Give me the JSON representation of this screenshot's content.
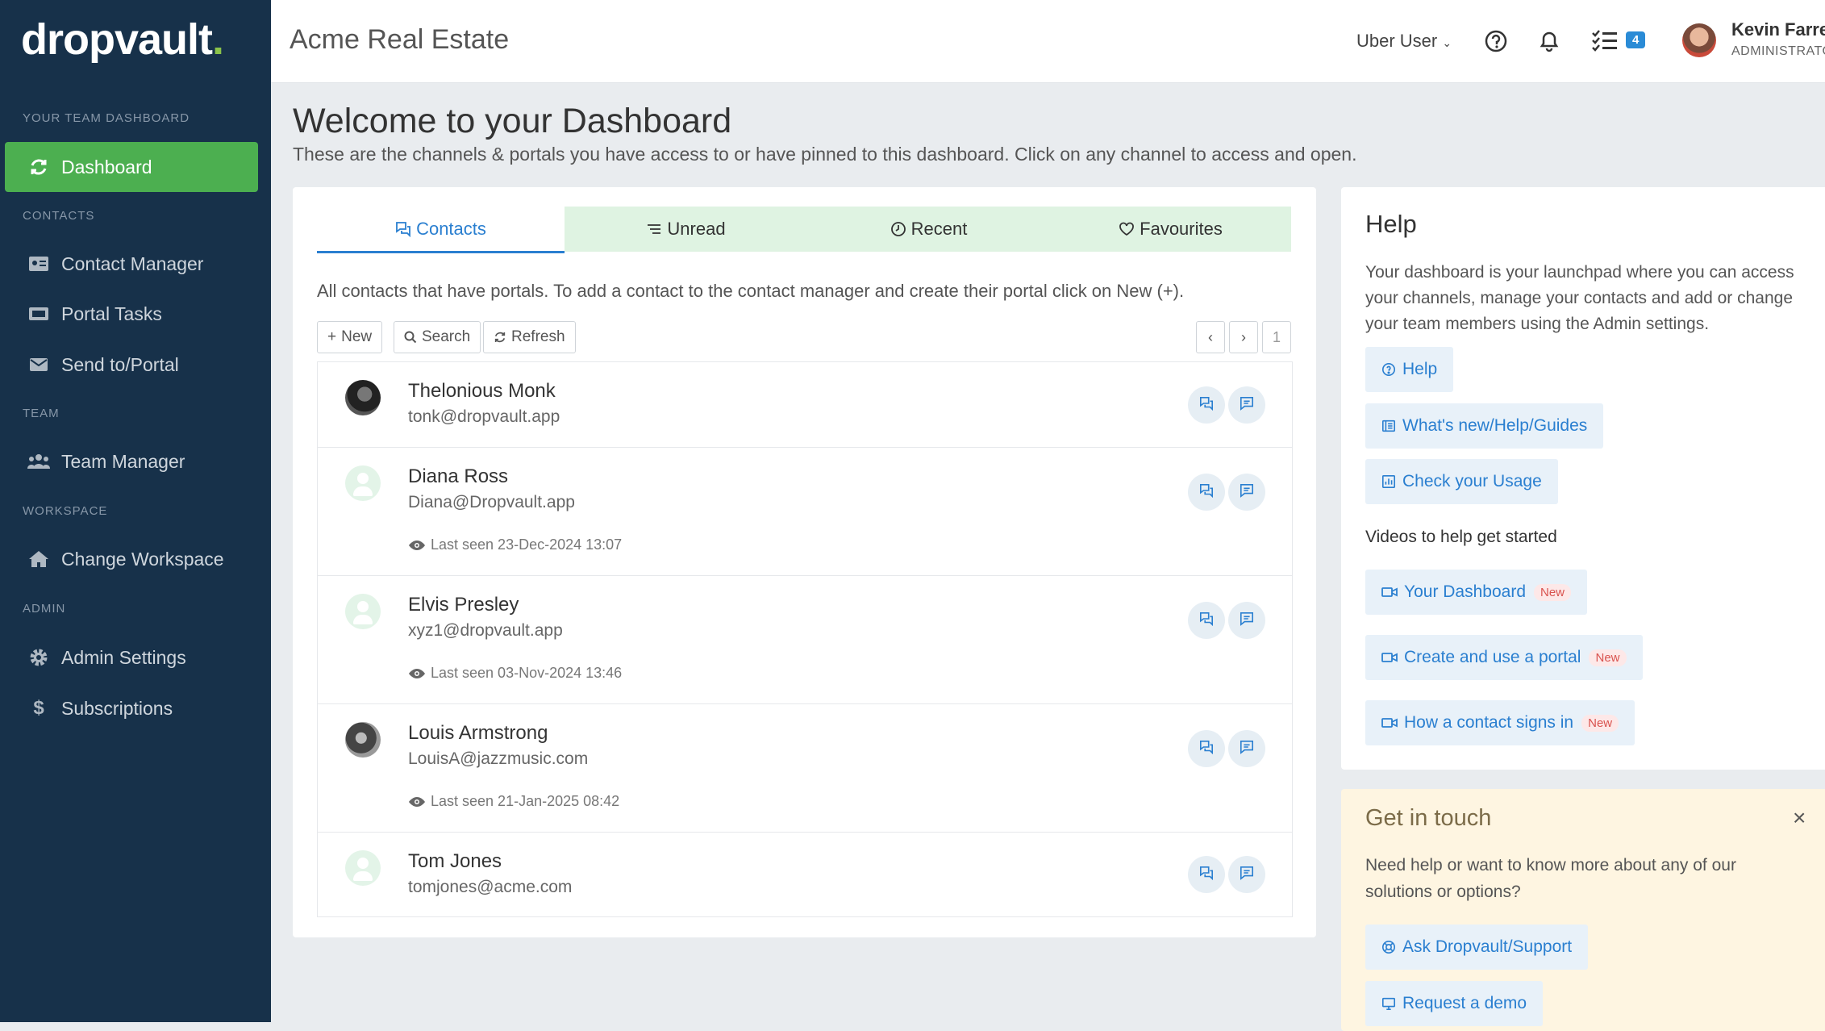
{
  "brand": {
    "name": "dropvault",
    "dot": "."
  },
  "sidebar": {
    "sections": {
      "team_dashboard": "YOUR TEAM DASHBOARD",
      "contacts": "CONTACTS",
      "team": "TEAM",
      "workspace": "WORKSPACE",
      "admin": "ADMIN"
    },
    "items": [
      {
        "label": "Dashboard",
        "icon": "refresh-icon",
        "active": true
      },
      {
        "label": "Contact Manager",
        "icon": "id-card-icon"
      },
      {
        "label": "Portal Tasks",
        "icon": "tasks-icon"
      },
      {
        "label": "Send to/Portal",
        "icon": "envelope-icon"
      },
      {
        "label": "Team Manager",
        "icon": "users-icon"
      },
      {
        "label": "Change Workspace",
        "icon": "home-icon"
      },
      {
        "label": "Admin Settings",
        "icon": "gear-icon"
      },
      {
        "label": "Subscriptions",
        "icon": "dollar-icon"
      }
    ]
  },
  "topbar": {
    "title": "Acme Real Estate",
    "user_menu": "Uber User",
    "tasks_badge": "4",
    "user_name": "Kevin Farrell",
    "user_role": "ADMINISTRATOR"
  },
  "main": {
    "heading": "Welcome to your Dashboard",
    "subheading": "These are the channels & portals you have access to or have pinned to this dashboard. Click on any channel to access and open.",
    "tabs": [
      {
        "label": "Contacts",
        "icon": "chat-icon",
        "active": true
      },
      {
        "label": "Unread",
        "icon": "list-icon"
      },
      {
        "label": "Recent",
        "icon": "clock-icon"
      },
      {
        "label": "Favourites",
        "icon": "heart-icon"
      }
    ],
    "info": "All contacts that have portals. To add a contact to the contact manager and create their portal click on New (+).",
    "toolbar": {
      "new": "New",
      "search": "Search",
      "refresh": "Refresh",
      "page": "1"
    },
    "contacts": [
      {
        "name": "Thelonious Monk",
        "email": "tonk@dropvault.app",
        "last_seen": ""
      },
      {
        "name": "Diana Ross",
        "email": "Diana@Dropvault.app",
        "last_seen": "Last seen 23-Dec-2024 13:07"
      },
      {
        "name": "Elvis Presley",
        "email": "xyz1@dropvault.app",
        "last_seen": "Last seen 03-Nov-2024 13:46"
      },
      {
        "name": "Louis Armstrong",
        "email": "LouisA@jazzmusic.com",
        "last_seen": "Last seen 21-Jan-2025 08:42"
      },
      {
        "name": "Tom Jones",
        "email": "tomjones@acme.com",
        "last_seen": ""
      }
    ]
  },
  "help": {
    "title": "Help",
    "description": "Your dashboard is your launchpad where you can access your channels, manage your contacts and add or change your team members using the Admin settings.",
    "links": [
      "Help",
      "What's new/Help/Guides",
      "Check your Usage"
    ],
    "videos_heading": "Videos to help get started",
    "videos": [
      "Your Dashboard",
      "Create and use a portal",
      "How a contact signs in"
    ],
    "new_tag": "New"
  },
  "touch": {
    "title": "Get in touch",
    "close": "×",
    "description": "Need help or want to know more about any of our solutions or options?",
    "links": [
      "Ask Dropvault/Support",
      "Request a demo"
    ]
  },
  "colors": {
    "sidebar": "#17314a",
    "accent_green": "#4caf50",
    "link_blue": "#2a7fd0",
    "tab_bg": "#dff3e2",
    "touch_bg": "#fef5e1"
  }
}
